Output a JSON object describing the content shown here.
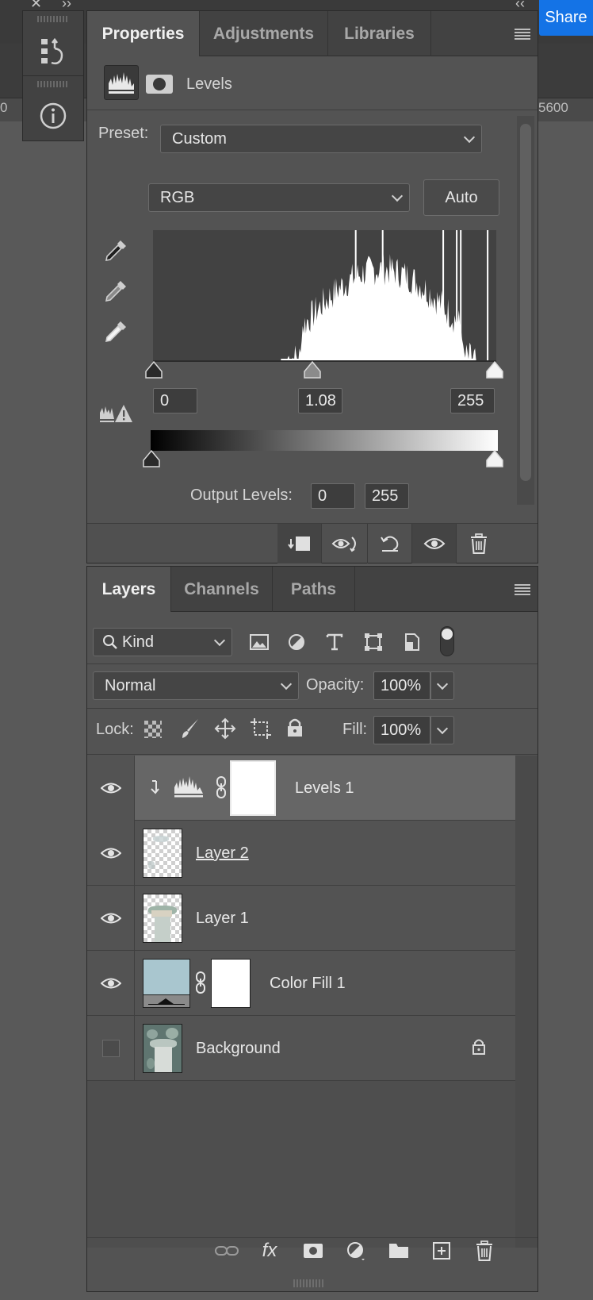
{
  "app": {
    "share_label": "Share",
    "ruler_left": "0",
    "ruler_right": "5600"
  },
  "properties_panel": {
    "tabs": [
      {
        "label": "Properties",
        "active": true
      },
      {
        "label": "Adjustments",
        "active": false
      },
      {
        "label": "Libraries",
        "active": false
      }
    ],
    "adjustment_title": "Levels",
    "preset_label": "Preset:",
    "preset_value": "Custom",
    "channel_value": "RGB",
    "auto_label": "Auto",
    "input_levels": {
      "black": "0",
      "gamma": "1.08",
      "white": "255"
    },
    "output_levels_label": "Output Levels:",
    "output_levels": {
      "black": "0",
      "white": "255"
    },
    "histogram": {
      "type": "histogram",
      "x_range": [
        0,
        255
      ],
      "dominant_range": [
        110,
        230
      ],
      "peaks": [
        150,
        170,
        215,
        225,
        228,
        248
      ]
    }
  },
  "layers_panel": {
    "tabs": [
      {
        "label": "Layers",
        "active": true
      },
      {
        "label": "Channels",
        "active": false
      },
      {
        "label": "Paths",
        "active": false
      }
    ],
    "filter_kind": "Kind",
    "blend_mode": "Normal",
    "opacity_label": "Opacity:",
    "opacity_value": "100%",
    "lock_label": "Lock:",
    "fill_label": "Fill:",
    "fill_value": "100%",
    "layers": [
      {
        "name": "Levels 1",
        "visible": true,
        "selected": true,
        "kind": "adjustment"
      },
      {
        "name": "Layer 2",
        "visible": true,
        "selected": false,
        "kind": "pixel"
      },
      {
        "name": "Layer 1",
        "visible": true,
        "selected": false,
        "kind": "pixel"
      },
      {
        "name": "Color Fill 1",
        "visible": true,
        "selected": false,
        "kind": "fill",
        "fill_color": "#a9c6cf"
      },
      {
        "name": "Background",
        "visible": false,
        "selected": false,
        "kind": "background",
        "locked": true
      }
    ]
  },
  "colors": {
    "accent": "#1473e6",
    "panel_bg": "#535353",
    "tab_bar": "#424242"
  }
}
